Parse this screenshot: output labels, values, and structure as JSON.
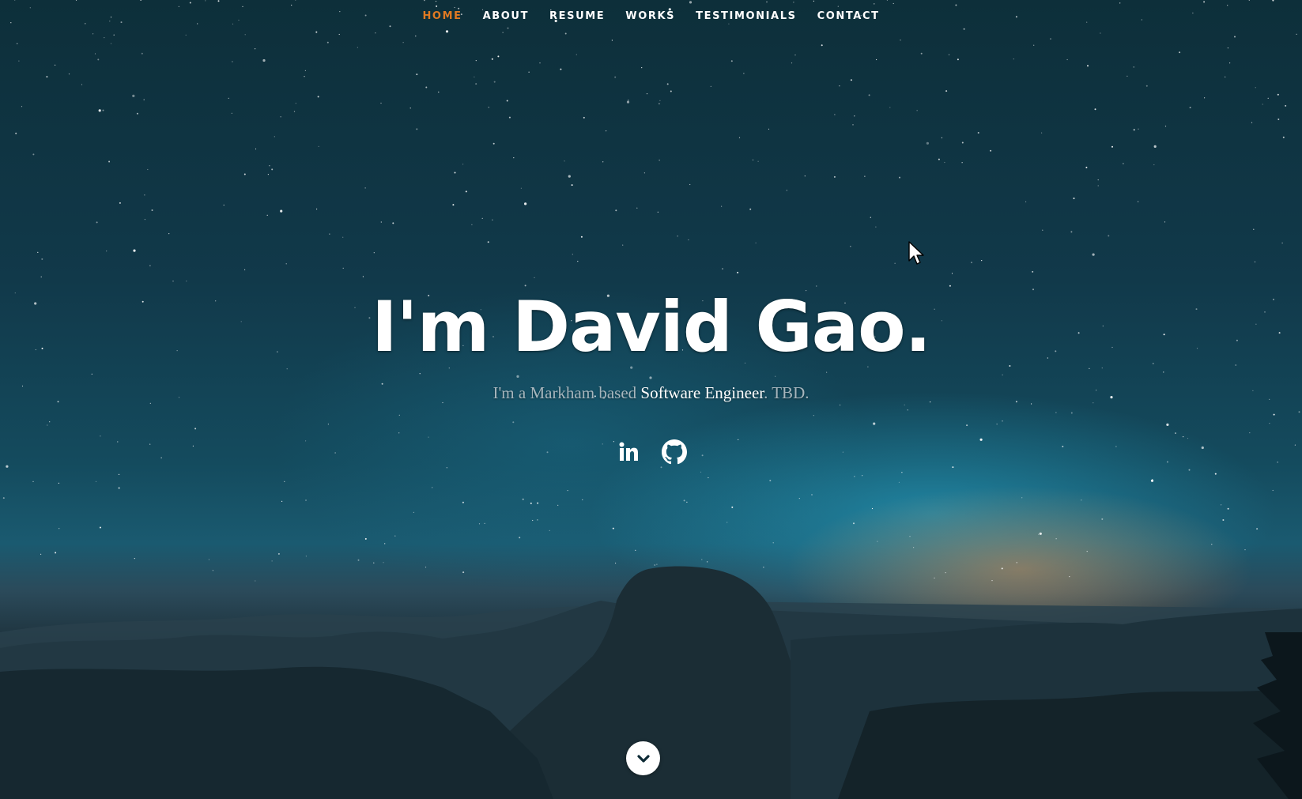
{
  "nav": {
    "items": [
      {
        "label": "HOME",
        "active": true
      },
      {
        "label": "ABOUT",
        "active": false
      },
      {
        "label": "RESUME",
        "active": false
      },
      {
        "label": "WORKS",
        "active": false
      },
      {
        "label": "TESTIMONIALS",
        "active": false
      },
      {
        "label": "CONTACT",
        "active": false
      }
    ],
    "active_color": "#e07a22"
  },
  "hero": {
    "headline": "I'm David Gao.",
    "subline_before": "I'm a Markham based ",
    "subline_emphasis": "Software Engineer",
    "subline_after": ". TBD."
  },
  "social": [
    {
      "icon": "linkedin-icon"
    },
    {
      "icon": "github-icon"
    }
  ],
  "scroll_down": {
    "icon": "chevron-down-icon"
  }
}
